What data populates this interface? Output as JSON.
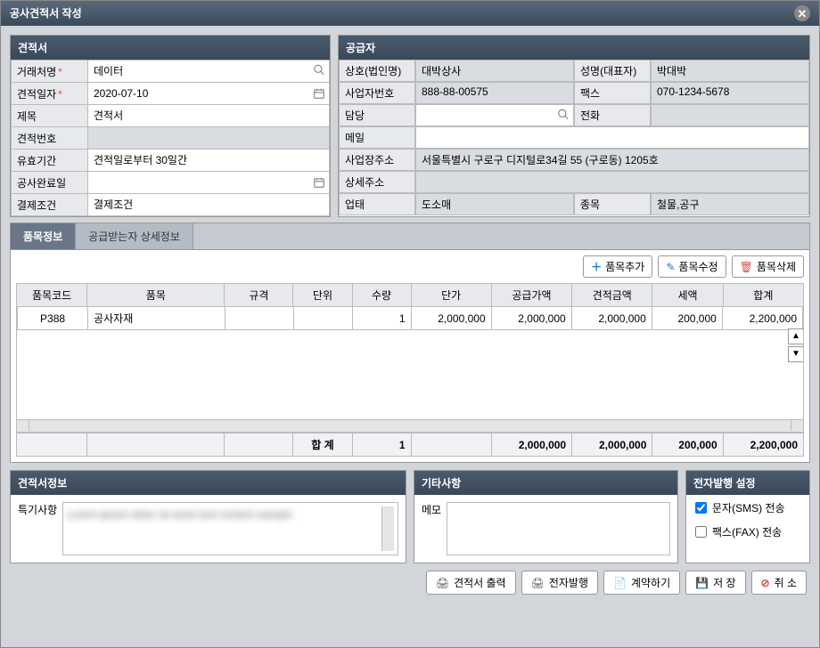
{
  "window": {
    "title": "공사견적서 작성"
  },
  "quote": {
    "header": "견적서",
    "labels": {
      "client": "거래처명",
      "date": "견적일자",
      "title": "제목",
      "number": "견적번호",
      "valid": "유효기간",
      "complete": "공사완료일",
      "payment": "결제조건"
    },
    "values": {
      "client": "데이터",
      "date": "2020-07-10",
      "title": "견적서",
      "number": "",
      "valid": "견적일로부터 30일간",
      "complete": "",
      "payment": "결제조건"
    }
  },
  "supplier": {
    "header": "공급자",
    "labels": {
      "company": "상호(법인명)",
      "ceo": "성명(대표자)",
      "bizno": "사업자번호",
      "fax": "팩스",
      "contact": "담당",
      "phone": "전화",
      "mail": "메일",
      "address": "사업장주소",
      "addressDetail": "상세주소",
      "bizType": "업태",
      "bizItem": "종목"
    },
    "values": {
      "company": "대박상사",
      "ceo": "박대박",
      "bizno": "888-88-00575",
      "fax": "070-1234-5678",
      "contact": "",
      "phone": "",
      "mail": "",
      "address": "서울특별시 구로구 디지털로34길 55 (구로동) 1205호",
      "addressDetail": "",
      "bizType": "도소매",
      "bizItem": "철물,공구"
    }
  },
  "tabs": {
    "t1": "품목정보",
    "t2": "공급받는자 상세정보"
  },
  "toolbar": {
    "add": "품목추가",
    "edit": "품목수정",
    "del": "품목삭제"
  },
  "grid": {
    "headers": {
      "code": "품목코드",
      "name": "품목",
      "spec": "규격",
      "unit": "단위",
      "qty": "수량",
      "price": "단가",
      "supply": "공급가액",
      "estAmt": "견적금액",
      "tax": "세액",
      "total": "합계"
    },
    "rows": [
      {
        "code": "P388",
        "name": "공사자재",
        "spec": "",
        "unit": "",
        "qty": "1",
        "price": "2,000,000",
        "supply": "2,000,000",
        "estAmt": "2,000,000",
        "tax": "200,000",
        "total": "2,200,000"
      }
    ],
    "totals": {
      "label": "합 계",
      "qty": "1",
      "supply": "2,000,000",
      "estAmt": "2,000,000",
      "tax": "200,000",
      "total": "2,200,000"
    }
  },
  "quoteInfo": {
    "header": "견적서정보",
    "label": "특기사항",
    "placeholder_text": "Lorem ipsum dolor sit amet text content sample"
  },
  "etc": {
    "header": "기타사항",
    "memoLabel": "메모",
    "memoValue": ""
  },
  "einvoice": {
    "header": "전자발행 설정",
    "sms": "문자(SMS) 전송",
    "fax": "팩스(FAX) 전송"
  },
  "actions": {
    "print": "견적서 출력",
    "issue": "전자발행",
    "contract": "계약하기",
    "save": "저 장",
    "cancel": "취 소"
  }
}
